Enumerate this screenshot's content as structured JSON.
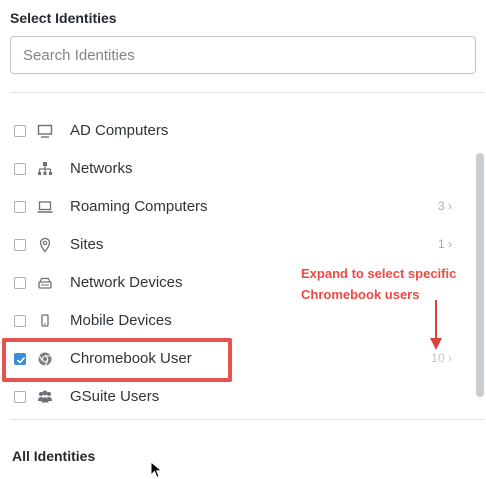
{
  "title": "Select Identities",
  "search": {
    "placeholder": "Search Identities"
  },
  "items": [
    {
      "label": "",
      "icon": "checkbox-partial",
      "count": "",
      "checked": false
    },
    {
      "label": "AD Computers",
      "icon": "monitor-icon",
      "count": "",
      "checked": false
    },
    {
      "label": "Networks",
      "icon": "network-icon",
      "count": "",
      "checked": false
    },
    {
      "label": "Roaming Computers",
      "icon": "laptop-icon",
      "count": "3",
      "checked": false
    },
    {
      "label": "Sites",
      "icon": "location-pin-icon",
      "count": "1",
      "checked": false
    },
    {
      "label": "Network Devices",
      "icon": "network-device-icon",
      "count": "",
      "checked": false
    },
    {
      "label": "Mobile Devices",
      "icon": "mobile-icon",
      "count": "",
      "checked": false
    },
    {
      "label": "Chromebook User",
      "icon": "chrome-icon",
      "count": "10",
      "checked": true
    },
    {
      "label": "GSuite Users",
      "icon": "users-icon",
      "count": "",
      "checked": false
    }
  ],
  "annotation": {
    "line1": "Expand to select specific",
    "line2": "Chromebook users"
  },
  "footer": {
    "title": "All Identities"
  },
  "colors": {
    "highlight": "#e8524e",
    "annotation": "#ee4a43",
    "checked": "#3c8ddb"
  }
}
